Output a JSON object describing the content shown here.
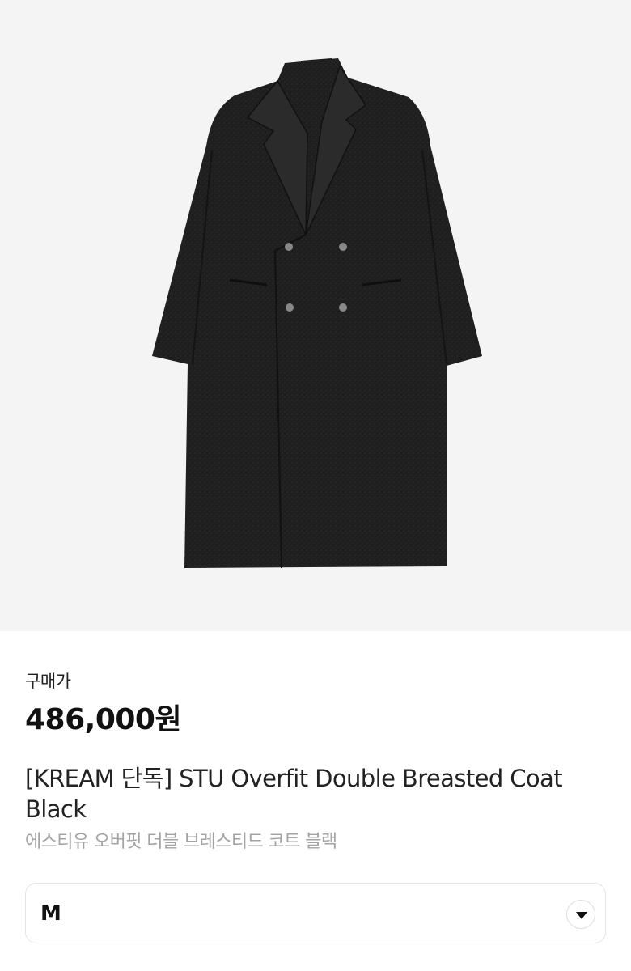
{
  "product": {
    "image_name": "coat-image",
    "price_label": "구매가",
    "price": "486,000원",
    "title": "[KREAM 단독] STU Overfit Double Breasted Coat Black",
    "subtitle": "에스티유 오버핏 더블 브레스티드 코트 블랙"
  },
  "size_select": {
    "value": "M",
    "icon": "chevron-down-icon"
  },
  "colors": {
    "image_bg": "#f4f4f4",
    "coat": "#1e1e1e",
    "subtitle": "#a3a3a3"
  }
}
